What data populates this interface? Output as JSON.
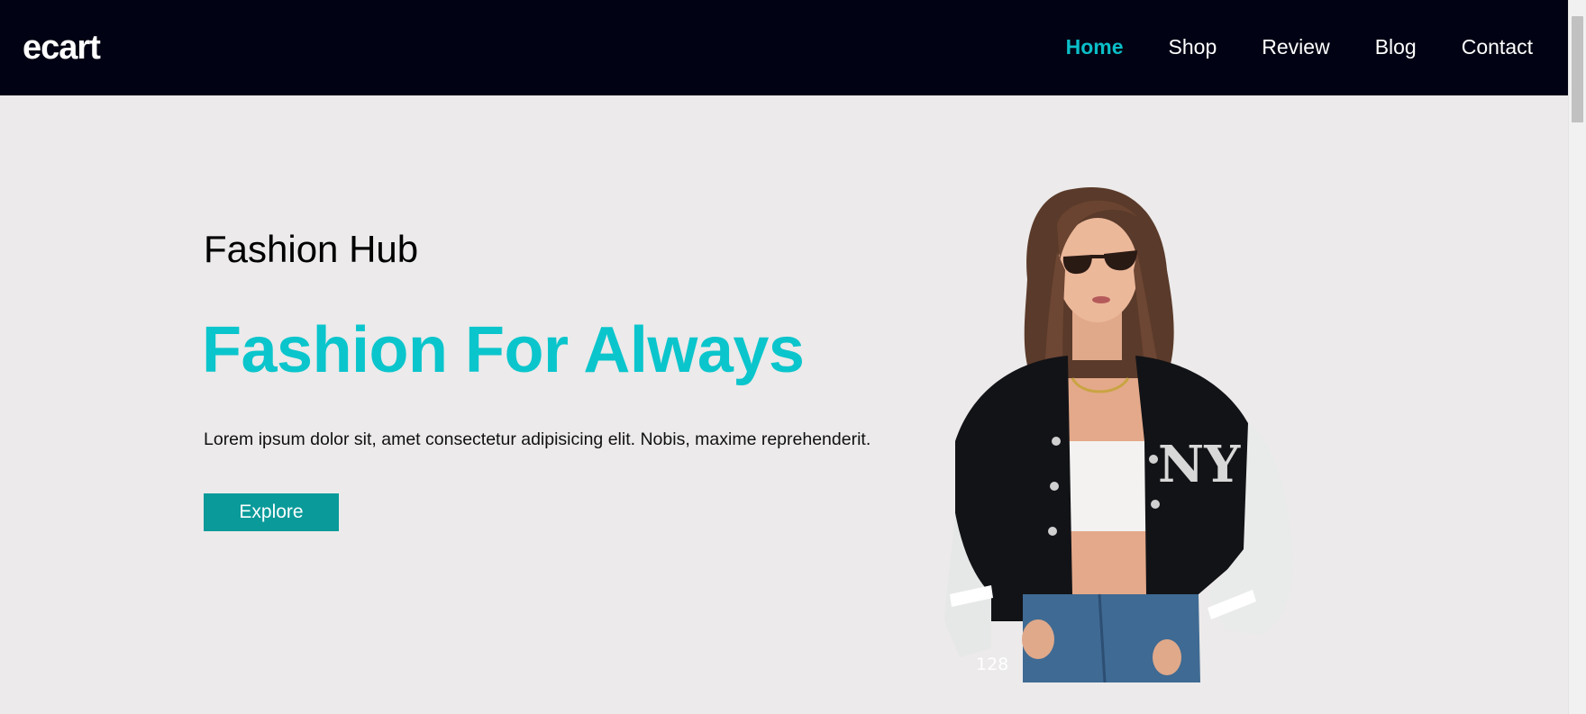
{
  "header": {
    "logo": "ecart",
    "nav": [
      {
        "label": "Home",
        "active": true
      },
      {
        "label": "Shop",
        "active": false
      },
      {
        "label": "Review",
        "active": false
      },
      {
        "label": "Blog",
        "active": false
      },
      {
        "label": "Contact",
        "active": false
      }
    ]
  },
  "hero": {
    "subtitle": "Fashion Hub",
    "title": "Fashion For Always",
    "description": "Lorem ipsum dolor sit, amet consectetur adipisicing elit. Nobis, maxime reprehenderit.",
    "button_label": "Explore",
    "image_caption": "128"
  },
  "colors": {
    "header_bg": "#010314",
    "accent": "#0bc5cc",
    "button_bg": "#0a9a9a",
    "page_bg": "#eceaea"
  }
}
